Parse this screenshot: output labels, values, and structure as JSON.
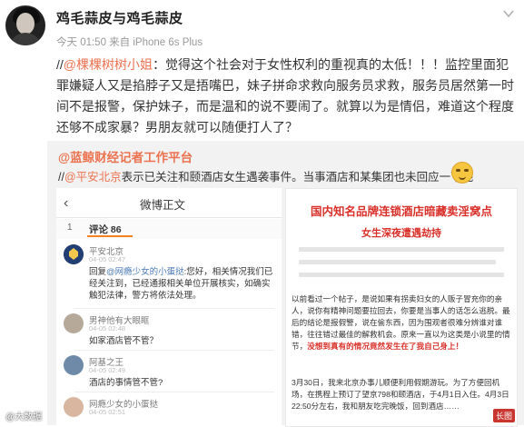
{
  "header": {
    "username": "鸡毛蒜皮与鸡毛蒜皮",
    "meta": "今天 01:50 来自 iPhone 6s Plus"
  },
  "post": {
    "prefix": "//",
    "mention": "@棵棵树树小姐",
    "text": "：觉得这个社会对于女性权利的重视真的太低！！！监控里面犯罪嫌疑人又是掐脖子又是捂嘴巴，妹子拼命求救向服务员求救，服务员居然第一时间不是报警，保护妹子，而是温和的说不要闹了。就算以为是情侣，难道这个程度还够不成家暴？男朋友就可以随便打人了？"
  },
  "repost": {
    "name": "@蓝鲸财经记者工作平台",
    "prefix": "//",
    "mention": "@平安北京",
    "text": "表示已关注和颐酒店女生遇袭事件。当事酒店和某集团也未回应一下吧"
  },
  "shot1": {
    "back": "‹",
    "title": "微博正文",
    "count": "1",
    "tab": "评论 86",
    "comments": [
      {
        "name": "平安北京",
        "time": "04-05 02:47",
        "text_prefix": "回复",
        "mention": "@网瘾少女的小蛋挞",
        "text": ":您好，相关情况我们已经关注到，已经通报相关单位开展核实，如确实触犯法律，警方将依法处理。"
      },
      {
        "name": "男神他有大眼眶",
        "time": "04-05 02:48",
        "text": "如家酒店管不管？"
      },
      {
        "name": "阿基之王",
        "time": "04-05 02:49",
        "text": "酒店的事情管不管?"
      },
      {
        "name": "网瘾少女的小蛋挞",
        "time": "04-05 02:51",
        "text": ""
      }
    ],
    "footer": "回复"
  },
  "shot2": {
    "headline": "国内知名品牌连锁酒店暗藏卖淫窝点",
    "subhead": "女生深夜遭遇劫持",
    "para1": "以前看过一个帖子，是说如果有拐卖妇女的人贩子冒充你的亲人，说你有精神问题要拉回去，你要是当事人的话怎么逃脱。最后的结论是报假警，说在偷东西，因为围观者很难分辨谁对谁错，往往错过最佳的解救机会。原来一直以为这类是小说里的情节，",
    "para1_red": "没想到真有的情况竟然发生在了我自己身上！",
    "para2": "3月30日，我来北京办事儿顺便利用假期游玩。为了方便回机场，在携程上预订了望京798和颐酒店，于4月1日入住。4月3日22:50分左右，我和朋友吃完晚饭，回到酒店……",
    "long_image": "长图",
    "watermark": "@大数据"
  }
}
